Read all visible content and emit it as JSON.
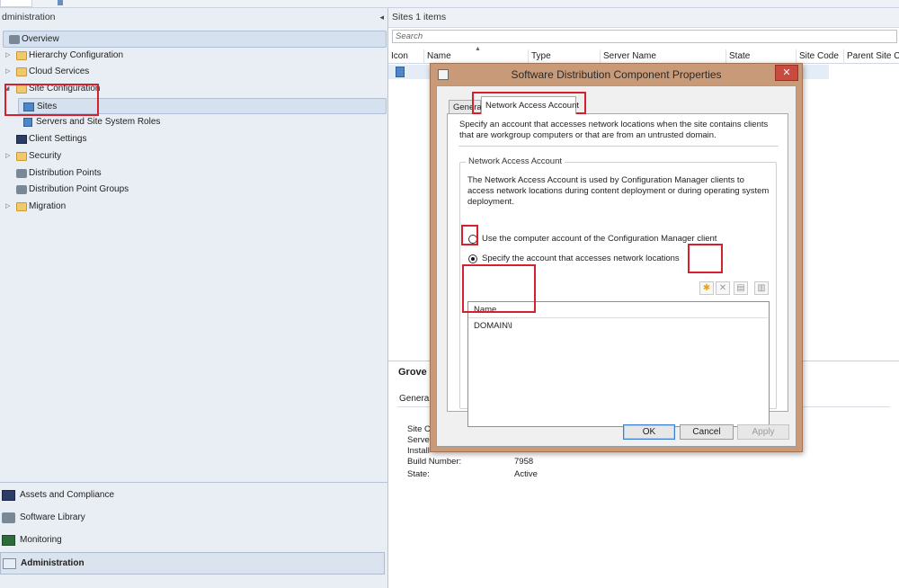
{
  "nav": {
    "header": "dministration",
    "collapse_glyph": "◂",
    "tree": [
      {
        "label": "Overview",
        "icon": "overview-icon",
        "expander": ""
      },
      {
        "label": "Hierarchy Configuration",
        "icon": "folder-icon",
        "expander": "▷"
      },
      {
        "label": "Cloud Services",
        "icon": "folder-icon",
        "expander": "▷"
      },
      {
        "label": "Site Configuration",
        "icon": "folder-icon",
        "expander": "◢"
      },
      {
        "label": "Sites",
        "icon": "sites-icon",
        "expander": ""
      },
      {
        "label": "Servers and Site System Roles",
        "icon": "server-roles-icon",
        "expander": ""
      },
      {
        "label": "Client Settings",
        "icon": "monitor-icon",
        "expander": ""
      },
      {
        "label": "Security",
        "icon": "folder-icon",
        "expander": "▷"
      },
      {
        "label": "Distribution Points",
        "icon": "distribution-point-icon",
        "expander": ""
      },
      {
        "label": "Distribution Point Groups",
        "icon": "distribution-group-icon",
        "expander": ""
      },
      {
        "label": "Migration",
        "icon": "folder-icon",
        "expander": "▷"
      }
    ],
    "wunderbar": [
      {
        "label": "Assets and Compliance",
        "icon": "assets-icon"
      },
      {
        "label": "Software Library",
        "icon": "library-icon"
      },
      {
        "label": "Monitoring",
        "icon": "monitoring-icon"
      },
      {
        "label": "Administration",
        "icon": "administration-icon"
      }
    ]
  },
  "content": {
    "header": "Sites 1 items",
    "search_placeholder": "Search",
    "columns": [
      "Icon",
      "Name",
      "Type",
      "Server Name",
      "State",
      "Site Code",
      "Parent Site Co"
    ],
    "details": {
      "title": "Grove S",
      "tab": "General",
      "labels": [
        "Site Co",
        "Server",
        "Install",
        "Build Number:",
        "State:"
      ],
      "values": [
        "",
        "",
        "",
        "7958",
        "Active"
      ]
    }
  },
  "dialog": {
    "title": "Software Distribution Component Properties",
    "close_glyph": "✕",
    "tabs": [
      "General",
      "Network Access Account"
    ],
    "intro": "Specify an account that accesses network locations when the site contains clients that are workgroup computers or that are from an untrusted domain.",
    "group_title": "Network Access Account",
    "group_desc": "The Network Access Account is used by Configuration Manager clients to access network locations during content deployment or during operating system deployment.",
    "radio_computer": "Use the computer account of the Configuration Manager client",
    "radio_specify": "Specify the account that accesses network locations",
    "toolbar": {
      "new": "✱",
      "delete": "✕",
      "properties": "▤",
      "verify": "▥"
    },
    "list_header": "Name",
    "list_rows": [
      "DOMAIN\\l"
    ],
    "buttons": {
      "ok": "OK",
      "cancel": "Cancel",
      "apply": "Apply"
    }
  },
  "colors": {
    "annotation": "#d4212e",
    "dialog_frame": "#c89a78",
    "close_button": "#c94a3e"
  }
}
